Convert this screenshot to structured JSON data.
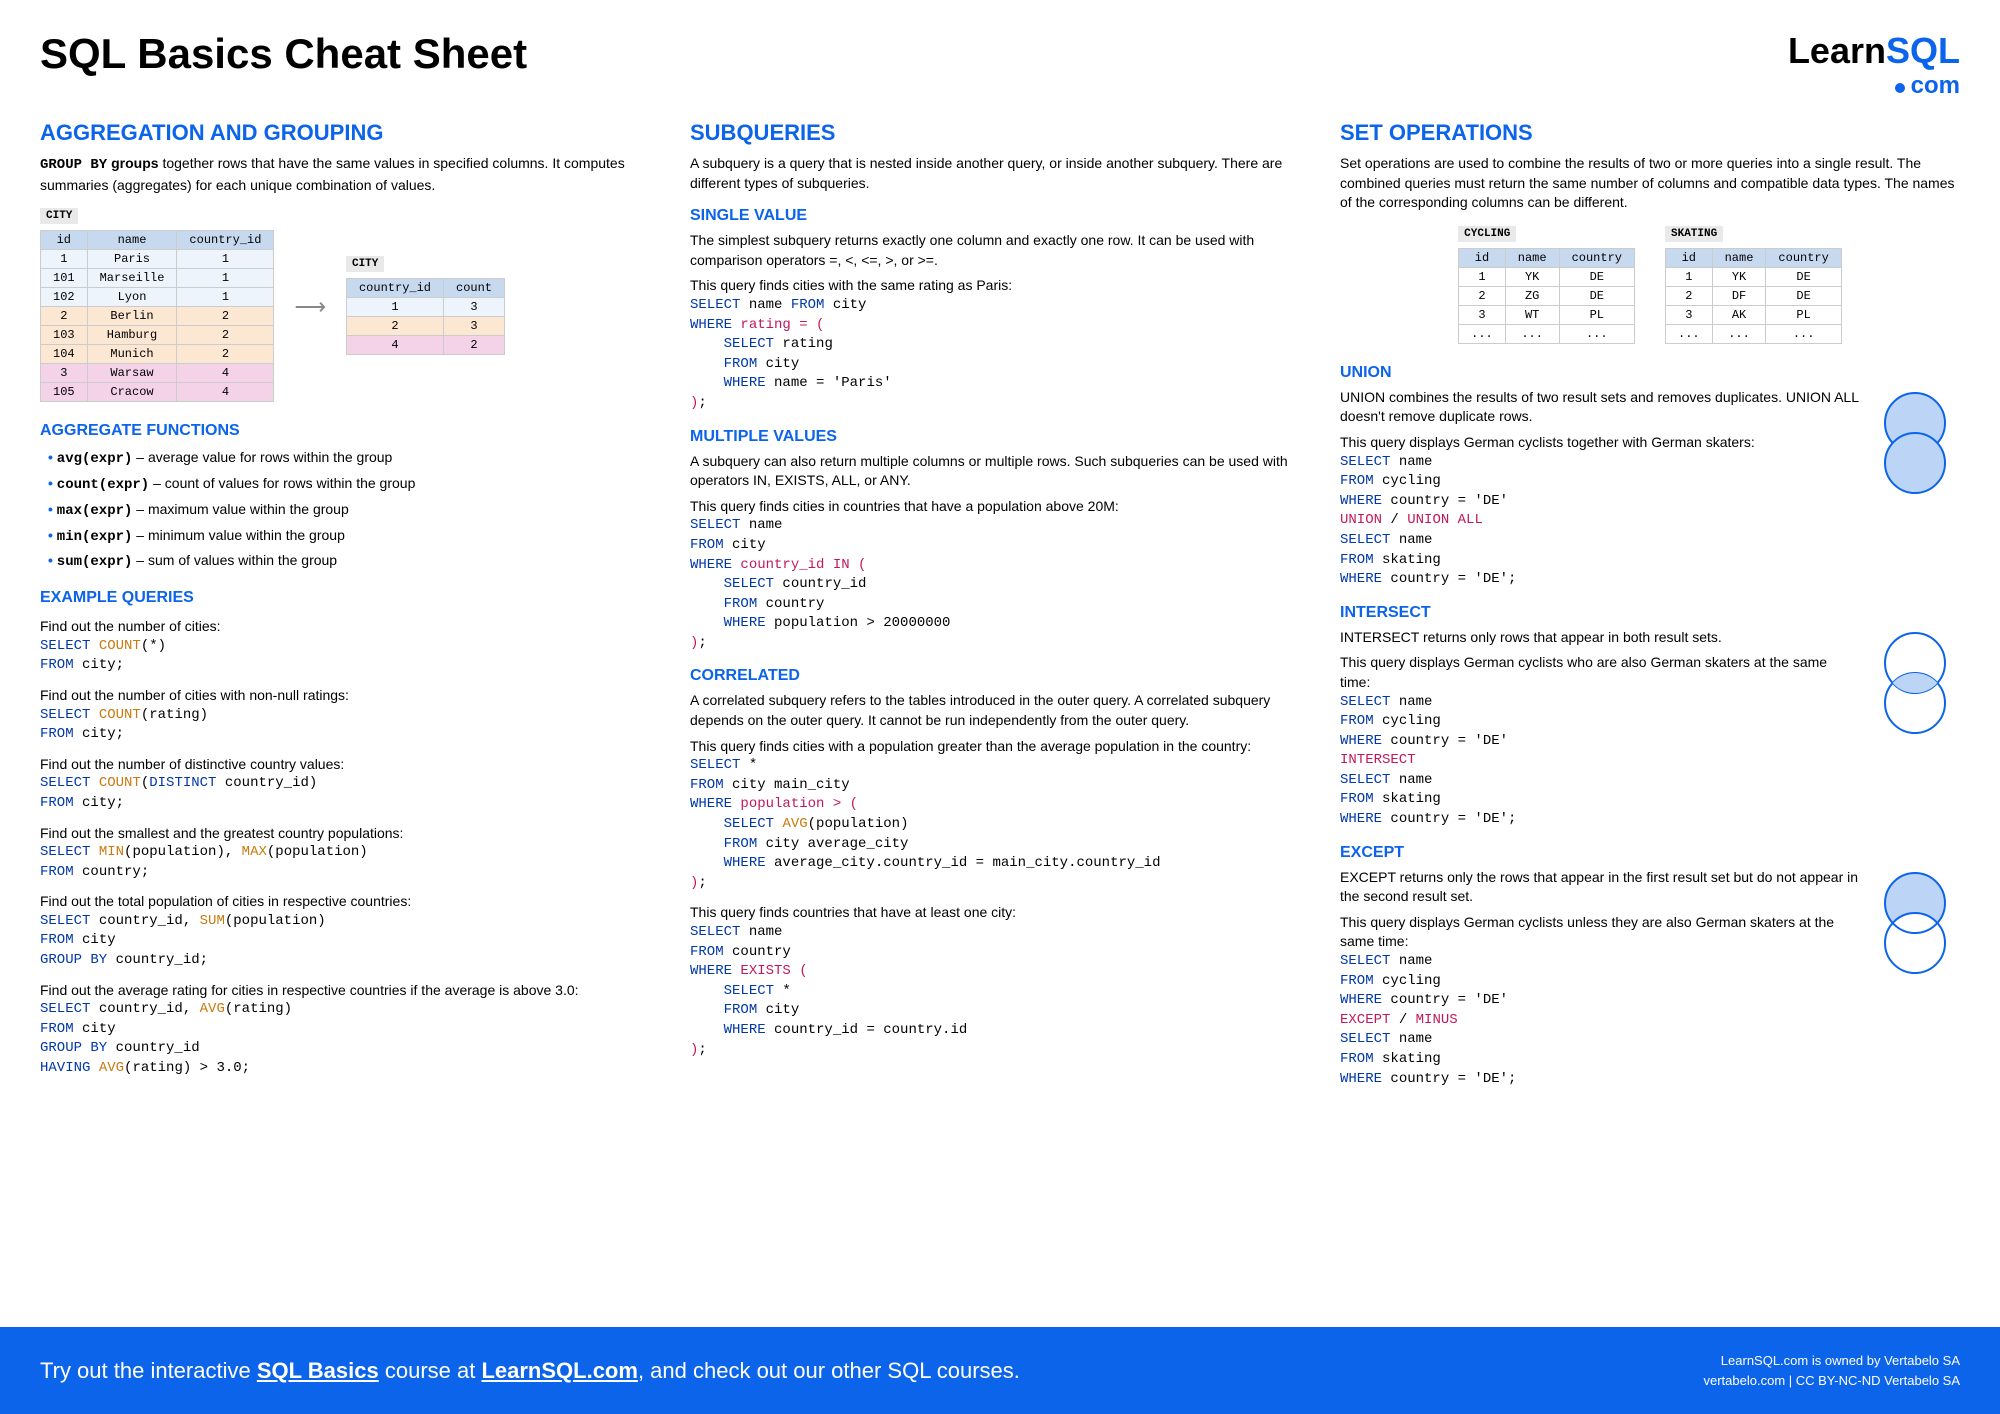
{
  "header": {
    "title": "SQL Basics Cheat Sheet",
    "logo_learn": "Learn",
    "logo_sql": "SQL",
    "logo_com": "com"
  },
  "col1": {
    "heading": "AGGREGATION AND GROUPING",
    "intro": "GROUP BY groups together rows that have the same values in specified columns. It computes summaries (aggregates) for each unique combination of values.",
    "city_label": "CITY",
    "city_headers": [
      "id",
      "name",
      "country_id"
    ],
    "city_rows": [
      {
        "cells": [
          "1",
          "Paris",
          "1"
        ],
        "cls": "r1"
      },
      {
        "cells": [
          "101",
          "Marseille",
          "1"
        ],
        "cls": "r1"
      },
      {
        "cells": [
          "102",
          "Lyon",
          "1"
        ],
        "cls": "r1"
      },
      {
        "cells": [
          "2",
          "Berlin",
          "2"
        ],
        "cls": "r2"
      },
      {
        "cells": [
          "103",
          "Hamburg",
          "2"
        ],
        "cls": "r2"
      },
      {
        "cells": [
          "104",
          "Munich",
          "2"
        ],
        "cls": "r2"
      },
      {
        "cells": [
          "3",
          "Warsaw",
          "4"
        ],
        "cls": "r4"
      },
      {
        "cells": [
          "105",
          "Cracow",
          "4"
        ],
        "cls": "r4"
      }
    ],
    "city2_headers": [
      "country_id",
      "count"
    ],
    "city2_rows": [
      {
        "cells": [
          "1",
          "3"
        ],
        "cls": "r1"
      },
      {
        "cells": [
          "2",
          "3"
        ],
        "cls": "r2"
      },
      {
        "cells": [
          "4",
          "2"
        ],
        "cls": "r4"
      }
    ],
    "agg_h": "AGGREGATE FUNCTIONS",
    "agg": [
      {
        "f": "avg(expr)",
        "d": " – average value for rows within the group"
      },
      {
        "f": "count(expr)",
        "d": " – count of values for rows within the group"
      },
      {
        "f": "max(expr)",
        "d": " – maximum value within the group"
      },
      {
        "f": "min(expr)",
        "d": " – minimum value within the group"
      },
      {
        "f": "sum(expr)",
        "d": " – sum of values within the group"
      }
    ],
    "ex_h": "EXAMPLE QUERIES",
    "ex": [
      {
        "t": "Find out the number of cities:",
        "c": "<span class='kw'>SELECT</span> <span class='fn'>COUNT</span>(*)\n<span class='kw'>FROM</span> city;"
      },
      {
        "t": "Find out the number of cities with non-null ratings:",
        "c": "<span class='kw'>SELECT</span> <span class='fn'>COUNT</span>(rating)\n<span class='kw'>FROM</span> city;"
      },
      {
        "t": "Find out the number of distinctive country values:",
        "c": "<span class='kw'>SELECT</span> <span class='fn'>COUNT</span>(<span class='kw'>DISTINCT</span> country_id)\n<span class='kw'>FROM</span> city;"
      },
      {
        "t": "Find out the smallest and the greatest country populations:",
        "c": "<span class='kw'>SELECT</span> <span class='fn'>MIN</span>(population), <span class='fn'>MAX</span>(population)\n<span class='kw'>FROM</span> country;"
      },
      {
        "t": "Find out the total population of cities in respective countries:",
        "c": "<span class='kw'>SELECT</span> country_id, <span class='fn'>SUM</span>(population)\n<span class='kw'>FROM</span> city\n<span class='kw'>GROUP BY</span> country_id;"
      },
      {
        "t": "Find out the average rating for cities in respective countries if the average is above 3.0:",
        "c": "<span class='kw'>SELECT</span> country_id, <span class='fn'>AVG</span>(rating)\n<span class='kw'>FROM</span> city\n<span class='kw'>GROUP BY</span> country_id\n<span class='kw'>HAVING</span> <span class='fn'>AVG</span>(rating) > 3.0;"
      }
    ]
  },
  "col2": {
    "heading": "SUBQUERIES",
    "intro": "A subquery is a query that is nested inside another query, or inside another subquery. There are different types of subqueries.",
    "sv_h": "SINGLE VALUE",
    "sv_t": "The simplest subquery returns exactly one column and exactly one row. It can be used with comparison operators =, <, <=, >, or >=.",
    "sv_t2": "This query finds cities with the same rating as Paris:",
    "sv_c": "<span class='kw'>SELECT</span> name <span class='kw'>FROM</span> city\n<span class='kw'>WHERE</span> <span class='op'>rating = (</span>\n    <span class='kw'>SELECT</span> rating\n    <span class='kw'>FROM</span> city\n    <span class='kw'>WHERE</span> name = 'Paris'\n<span class='op'>)</span>;",
    "mv_h": "MULTIPLE VALUES",
    "mv_t": "A subquery can also return multiple columns or multiple rows. Such subqueries can be used with operators IN, EXISTS, ALL, or ANY.",
    "mv_t2": "This query finds cities in countries that have a population above 20M:",
    "mv_c": "<span class='kw'>SELECT</span> name\n<span class='kw'>FROM</span> city\n<span class='kw'>WHERE</span> <span class='op'>country_id IN (</span>\n    <span class='kw'>SELECT</span> country_id\n    <span class='kw'>FROM</span> country\n    <span class='kw'>WHERE</span> population > 20000000\n<span class='op'>)</span>;",
    "co_h": "CORRELATED",
    "co_t": "A correlated subquery refers to the tables introduced in the outer query. A correlated subquery depends on the outer query. It cannot be run independently from the outer query.",
    "co_t2": "This query finds cities with a population greater than the average population in the country:",
    "co_c": "<span class='kw'>SELECT</span> *\n<span class='kw'>FROM</span> city main_city\n<span class='kw'>WHERE</span> <span class='op'>population > (</span>\n    <span class='kw'>SELECT</span> <span class='fn'>AVG</span>(population)\n    <span class='kw'>FROM</span> city average_city\n    <span class='kw'>WHERE</span> average_city.country_id = main_city.country_id\n<span class='op'>)</span>;",
    "co_t3": "This query finds countries that have at least one city:",
    "co_c2": "<span class='kw'>SELECT</span> name\n<span class='kw'>FROM</span> country\n<span class='kw'>WHERE</span> <span class='op'>EXISTS (</span>\n    <span class='kw'>SELECT</span> *\n    <span class='kw'>FROM</span> city\n    <span class='kw'>WHERE</span> country_id = country.id\n<span class='op'>)</span>;"
  },
  "col3": {
    "heading": "SET OPERATIONS",
    "intro": "Set operations are used to combine the results of two or more queries into a single result. The combined queries must return the same number of columns and compatible data types. The names of the corresponding columns can be different.",
    "cyc_lbl": "CYCLING",
    "skt_lbl": "SKATING",
    "tbl_headers": [
      "id",
      "name",
      "country"
    ],
    "cyc": [
      [
        "1",
        "YK",
        "DE"
      ],
      [
        "2",
        "ZG",
        "DE"
      ],
      [
        "3",
        "WT",
        "PL"
      ],
      [
        "...",
        "...",
        "..."
      ]
    ],
    "skt": [
      [
        "1",
        "YK",
        "DE"
      ],
      [
        "2",
        "DF",
        "DE"
      ],
      [
        "3",
        "AK",
        "PL"
      ],
      [
        "...",
        "...",
        "..."
      ]
    ],
    "un_h": "UNION",
    "un_t": "UNION combines the results of two result sets and removes duplicates. UNION ALL doesn't remove duplicate rows.",
    "un_t2": "This query displays German cyclists together with German skaters:",
    "un_c": "<span class='kw'>SELECT</span> name\n<span class='kw'>FROM</span> cycling\n<span class='kw'>WHERE</span> country = 'DE'\n<span class='op'>UNION</span> / <span class='op'>UNION ALL</span>\n<span class='kw'>SELECT</span> name\n<span class='kw'>FROM</span> skating\n<span class='kw'>WHERE</span> country = 'DE';",
    "in_h": "INTERSECT",
    "in_t": "INTERSECT returns only rows that appear in both result sets.",
    "in_t2": "This query displays German cyclists who are also German skaters at the same time:",
    "in_c": "<span class='kw'>SELECT</span> name\n<span class='kw'>FROM</span> cycling\n<span class='kw'>WHERE</span> country = 'DE'\n<span class='op'>INTERSECT</span>\n<span class='kw'>SELECT</span> name\n<span class='kw'>FROM</span> skating\n<span class='kw'>WHERE</span> country = 'DE';",
    "ex_h": "EXCEPT",
    "ex_t": "EXCEPT returns only the rows that appear in the first result set but do not appear in the second result set.",
    "ex_t2": "This query displays German cyclists unless they are also German skaters at the same time:",
    "ex_c": "<span class='kw'>SELECT</span> name\n<span class='kw'>FROM</span> cycling\n<span class='kw'>WHERE</span> country = 'DE'\n<span class='op'>EXCEPT</span> / <span class='op'>MINUS</span>\n<span class='kw'>SELECT</span> name\n<span class='kw'>FROM</span> skating\n<span class='kw'>WHERE</span> country = 'DE';"
  },
  "footer": {
    "left_pre": "Try out the interactive ",
    "left_link1": "SQL Basics",
    "left_mid": " course at ",
    "left_link2": "LearnSQL.com",
    "left_post": ", and check out our other SQL courses.",
    "right1": "LearnSQL.com is owned by Vertabelo SA",
    "right2": "vertabelo.com | CC BY-NC-ND Vertabelo SA"
  }
}
